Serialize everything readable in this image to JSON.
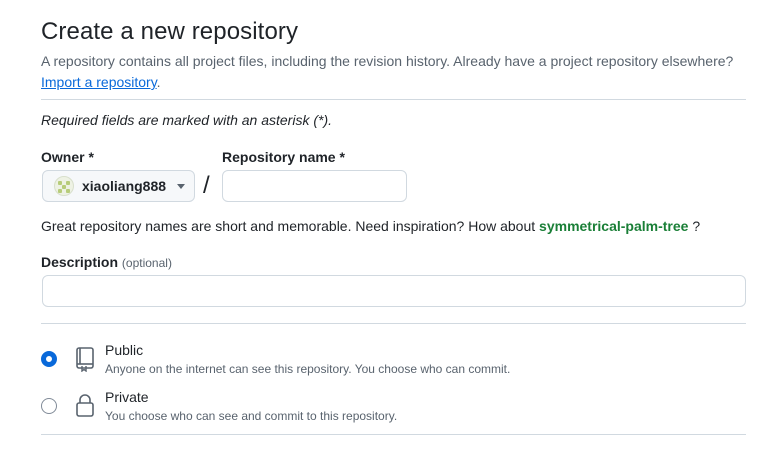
{
  "header": {
    "title": "Create a new repository",
    "subtitle": "A repository contains all project files, including the revision history. Already have a project repository elsewhere?",
    "import_link": "Import a repository",
    "import_suffix": "."
  },
  "form": {
    "required_note": "Required fields are marked with an asterisk (*).",
    "owner_label": "Owner *",
    "owner_value": "xiaoliang888",
    "separator": "/",
    "repo_name_label": "Repository name *",
    "repo_name_value": "",
    "hint_prefix": "Great repository names are short and memorable. Need inspiration? How about",
    "hint_suggestion": "symmetrical-palm-tree",
    "hint_suffix": "?",
    "description_label": "Description",
    "description_optional": "(optional)",
    "description_value": ""
  },
  "visibility": {
    "selected": "public",
    "options": [
      {
        "id": "public",
        "label": "Public",
        "description": "Anyone on the internet can see this repository. You choose who can commit.",
        "icon": "repo-book-icon"
      },
      {
        "id": "private",
        "label": "Private",
        "description": "You choose who can see and commit to this repository.",
        "icon": "lock-icon"
      }
    ]
  },
  "colors": {
    "accent": "#0969da",
    "suggestion": "#1a7f37",
    "border": "#d1d9e0",
    "muted_text": "#59636e"
  }
}
